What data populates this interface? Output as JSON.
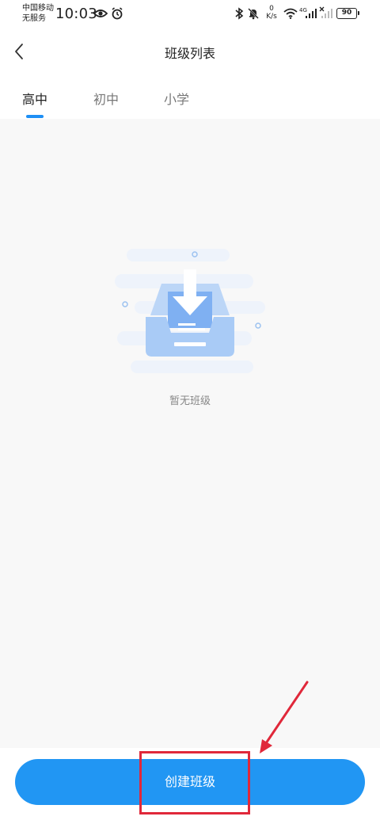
{
  "status_bar": {
    "carrier_line1": "中国移动",
    "carrier_line2": "无服务",
    "time": "10:03",
    "speed_value": "0",
    "speed_unit": "K/s",
    "network_tag": "4G",
    "battery": "90"
  },
  "header": {
    "title": "班级列表"
  },
  "tabs": [
    {
      "label": "高中",
      "active": true
    },
    {
      "label": "初中",
      "active": false
    },
    {
      "label": "小学",
      "active": false
    }
  ],
  "empty_state": {
    "message": "暂无班级"
  },
  "actions": {
    "create_label": "创建班级"
  },
  "colors": {
    "accent": "#2196f3",
    "highlight": "#e0283a",
    "background": "#f8f8f8"
  }
}
